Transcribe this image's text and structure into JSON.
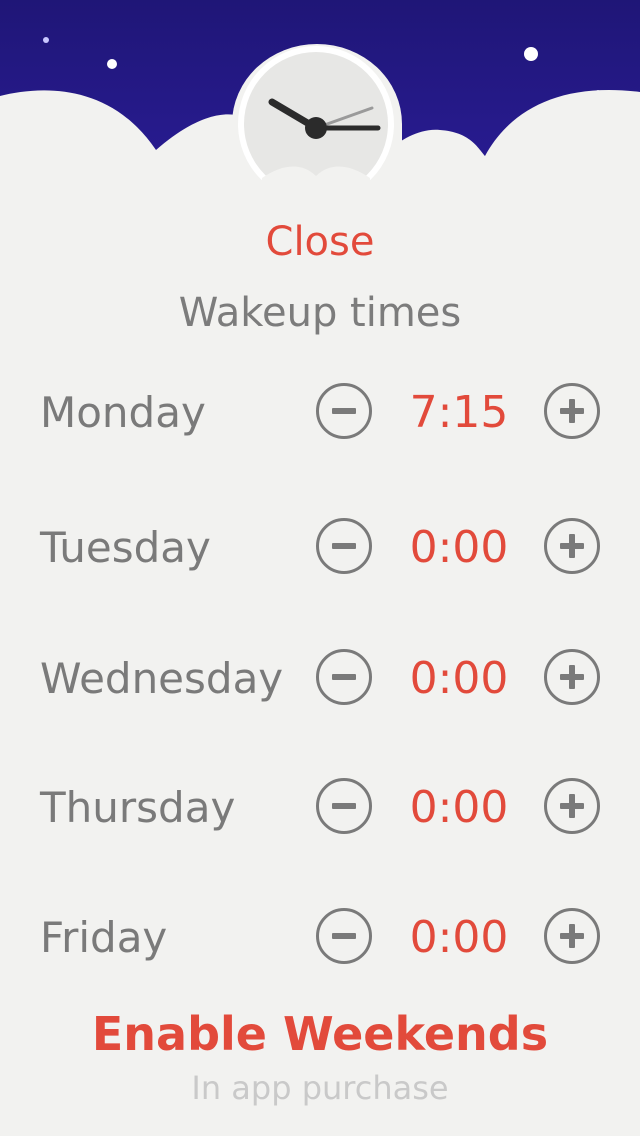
{
  "header": {
    "close_label": "Close",
    "title": "Wakeup times"
  },
  "days": [
    {
      "label": "Monday",
      "time": "7:15"
    },
    {
      "label": "Tuesday",
      "time": "0:00"
    },
    {
      "label": "Wednesday",
      "time": "0:00"
    },
    {
      "label": "Thursday",
      "time": "0:00"
    },
    {
      "label": "Friday",
      "time": "0:00"
    }
  ],
  "footer": {
    "enable_label": "Enable Weekends",
    "note": "In app purchase"
  },
  "icons": {
    "decrement": "minus-circle-icon",
    "increment": "plus-circle-icon",
    "logo": "clock-icon"
  },
  "colors": {
    "sky": "#25198a",
    "accent": "#e24a3b",
    "text": "#7a7a7a",
    "background": "#f2f2f0"
  }
}
